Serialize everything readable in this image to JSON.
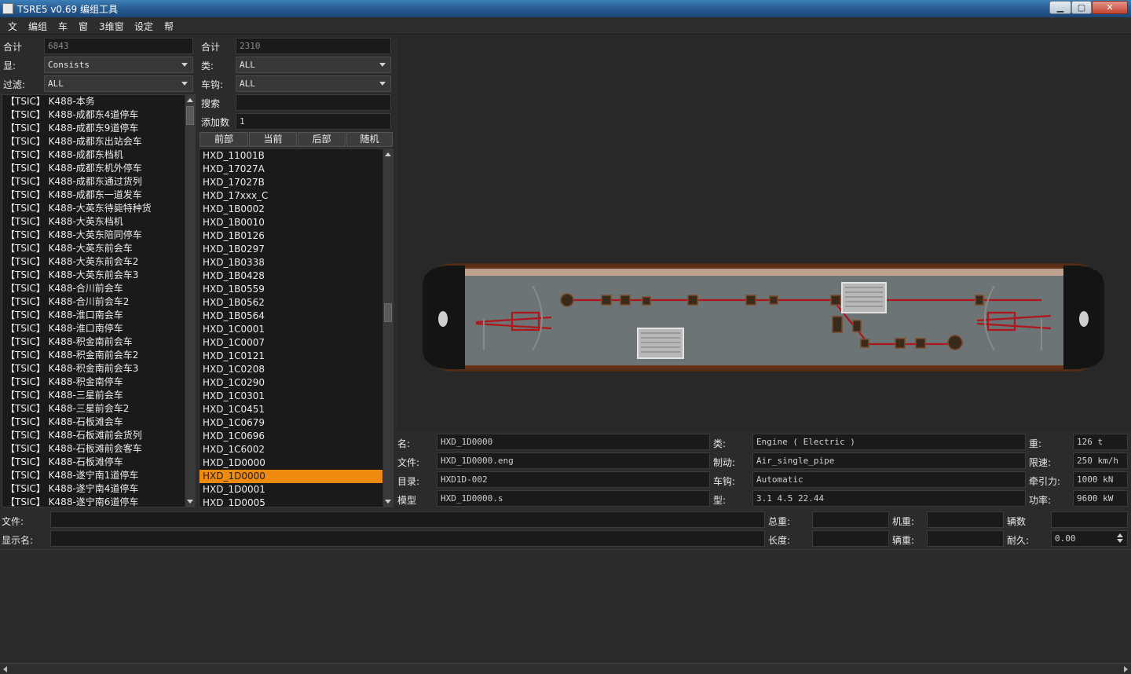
{
  "window": {
    "title": "TSRE5 v0.69 编组工具",
    "minimize_label": "▁",
    "maximize_label": "▢",
    "close_label": "✕"
  },
  "menu": [
    "文",
    "编组",
    "车",
    "窗",
    "3维窗",
    "设定",
    "帮"
  ],
  "consists_panel": {
    "total_label": "合计",
    "total_value": "6843",
    "display_label": "显:",
    "display_value": "Consists",
    "filter_label": "过滤:",
    "filter_value": "ALL",
    "items": [
      "【TSIC】 K488-本务",
      "【TSIC】 K488-成都东4道停车",
      "【TSIC】 K488-成都东9道停车",
      "【TSIC】 K488-成都东出站会车",
      "【TSIC】 K488-成都东档机",
      "【TSIC】 K488-成都东机外停车",
      "【TSIC】 K488-成都东通过货列",
      "【TSIC】 K488-成都东一道发车",
      "【TSIC】 K488-大英东待毙特种货",
      "【TSIC】 K488-大英东档机",
      "【TSIC】 K488-大英东陪同停车",
      "【TSIC】 K488-大英东前会车",
      "【TSIC】 K488-大英东前会车2",
      "【TSIC】 K488-大英东前会车3",
      "【TSIC】 K488-合川前会车",
      "【TSIC】 K488-合川前会车2",
      "【TSIC】 K488-淮口南会车",
      "【TSIC】 K488-淮口南停车",
      "【TSIC】 K488-积金南前会车",
      "【TSIC】 K488-积金南前会车2",
      "【TSIC】 K488-积金南前会车3",
      "【TSIC】 K488-积金南停车",
      "【TSIC】 K488-三星前会车",
      "【TSIC】 K488-三星前会车2",
      "【TSIC】 K488-石板滩会车",
      "【TSIC】 K488-石板滩前会货列",
      "【TSIC】 K488-石板滩前会客车",
      "【TSIC】 K488-石板滩停车",
      "【TSIC】 K488-遂宁南1道停车",
      "【TSIC】 K488-遂宁南4道停车",
      "【TSIC】 K488-遂宁南6道停车"
    ]
  },
  "eng_panel": {
    "total_label": "合计",
    "total_value": "2310",
    "type_label": "类:",
    "type_value": "ALL",
    "coupler_label": "车钩:",
    "coupler_value": "ALL",
    "search_label": "搜索",
    "search_value": "",
    "add_count_label": "添加数",
    "add_count_value": "1",
    "buttons": [
      "前部",
      "当前",
      "后部",
      "随机"
    ],
    "items": [
      "HXD_11001B",
      "HXD_17027A",
      "HXD_17027B",
      "HXD_17xxx_C",
      "HXD_1B0002",
      "HXD_1B0010",
      "HXD_1B0126",
      "HXD_1B0297",
      "HXD_1B0338",
      "HXD_1B0428",
      "HXD_1B0559",
      "HXD_1B0562",
      "HXD_1B0564",
      "HXD_1C0001",
      "HXD_1C0007",
      "HXD_1C0121",
      "HXD_1C0208",
      "HXD_1C0290",
      "HXD_1C0301",
      "HXD_1C0451",
      "HXD_1C0679",
      "HXD_1C0696",
      "HXD_1C6002",
      "HXD_1D0000",
      "HXD_1D0000",
      "HXD_1D0001",
      "HXD_1D0005"
    ],
    "selected_index": 24
  },
  "details": {
    "name_label": "名:",
    "name_value": "HXD_1D0000",
    "file_label": "文件:",
    "file_value": "HXD_1D0000.eng",
    "dir_label": "目录:",
    "dir_value": "HXD1D-002",
    "model_label": "模型",
    "model_value": "HXD_1D0000.s",
    "type_label": "类:",
    "type_value": "Engine ( Electric )",
    "brake_label": "制动:",
    "brake_value": "Air_single_pipe",
    "coupler_label": "车钩:",
    "coupler_value": "Automatic",
    "shape_label": "型:",
    "shape_value": "3.1 4.5 22.44",
    "weight_label": "重:",
    "weight_value": "126 t",
    "speed_label": "限速:",
    "speed_value": "250 km/h",
    "traction_label": "牵引力:",
    "traction_value": "1000 kN",
    "power_label": "功率:",
    "power_value": "9600 kW"
  },
  "consist_info": {
    "file_label": "文件:",
    "file_value": "",
    "display_name_label": "显示名:",
    "display_name_value": "",
    "total_weight_label": "总重:",
    "total_weight_value": "",
    "length_label": "长度:",
    "length_value": "",
    "engine_weight_label": "机重:",
    "engine_weight_value": "",
    "car_weight_label": "辆重:",
    "car_weight_value": "",
    "car_count_label": "辆数",
    "car_count_value": "",
    "durability_label": "耐久:",
    "durability_value": "0.00"
  },
  "colors": {
    "selection": "#ef8a10",
    "loco_body": "#d9601a",
    "underframe": "#6c7475"
  }
}
